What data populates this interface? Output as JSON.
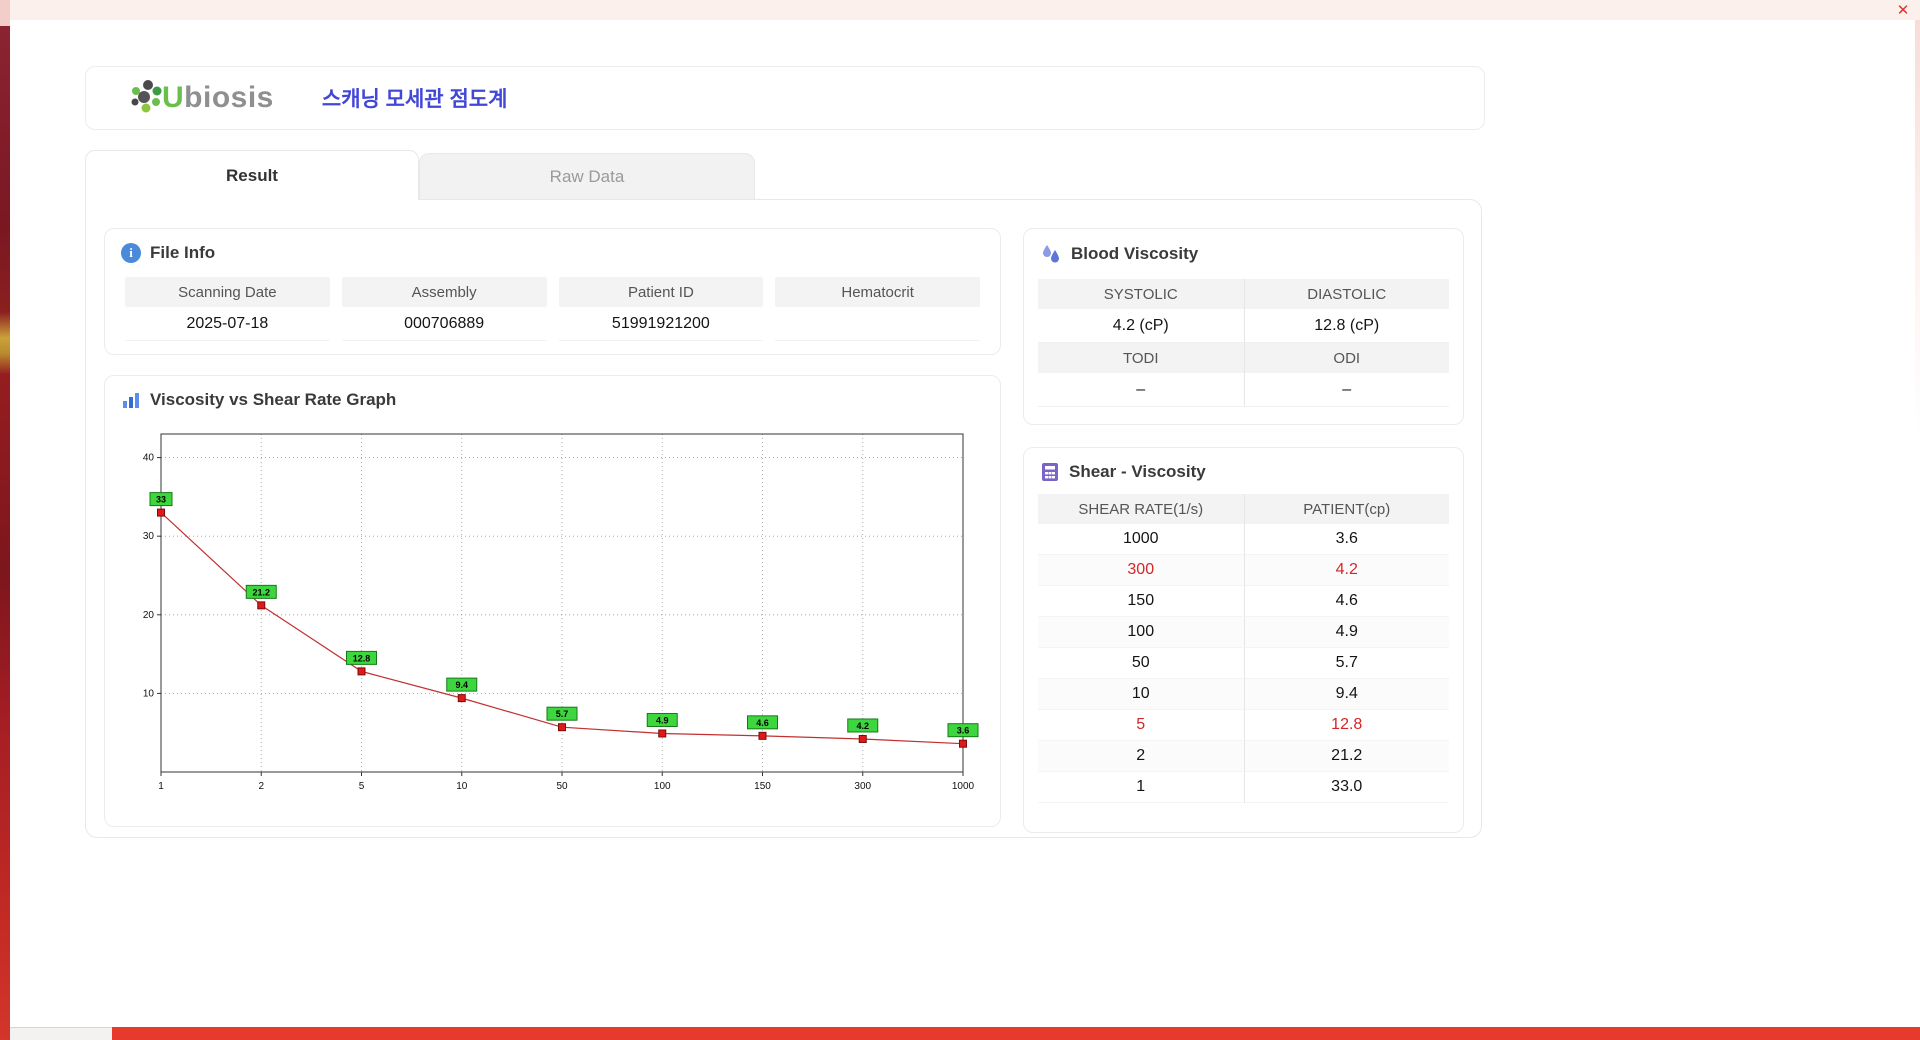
{
  "window": {
    "close_glyph": "✕"
  },
  "header": {
    "brand": "Ubiosis",
    "title": "스캐닝 모세관 점도계"
  },
  "tabs": {
    "result": "Result",
    "raw_data": "Raw Data"
  },
  "icons": {
    "info_glyph": "i"
  },
  "file_info": {
    "title": "File Info",
    "fields": [
      {
        "label": "Scanning Date",
        "value": "2025-07-18"
      },
      {
        "label": "Assembly",
        "value": "000706889"
      },
      {
        "label": "Patient ID",
        "value": "51991921200"
      },
      {
        "label": "Hematocrit",
        "value": ""
      }
    ]
  },
  "graph_section": {
    "title": "Viscosity vs Shear Rate Graph"
  },
  "blood_viscosity": {
    "title": "Blood Viscosity",
    "headers1": [
      "SYSTOLIC",
      "DIASTOLIC"
    ],
    "values1": [
      "4.2 (cP)",
      "12.8 (cP)"
    ],
    "headers2": [
      "TODI",
      "ODI"
    ],
    "values2": [
      "–",
      "–"
    ]
  },
  "shear_table": {
    "title": "Shear - Viscosity",
    "headers": [
      "SHEAR RATE(1/s)",
      "PATIENT(cp)"
    ],
    "rows": [
      [
        "1000",
        "3.6"
      ],
      [
        "300",
        "4.2"
      ],
      [
        "150",
        "4.6"
      ],
      [
        "100",
        "4.9"
      ],
      [
        "50",
        "5.7"
      ],
      [
        "10",
        "9.4"
      ],
      [
        "5",
        "12.8"
      ],
      [
        "2",
        "21.2"
      ],
      [
        "1",
        "33.0"
      ]
    ],
    "highlight_rows": [
      1,
      6
    ]
  },
  "chart_data": {
    "type": "line",
    "title": "Viscosity vs Shear Rate Graph",
    "xlabel": "",
    "ylabel": "",
    "x": [
      "1",
      "2",
      "5",
      "10",
      "50",
      "100",
      "150",
      "300",
      "1000"
    ],
    "values": [
      33,
      21.2,
      12.8,
      9.4,
      5.7,
      4.9,
      4.6,
      4.2,
      3.6
    ],
    "labels": [
      "33",
      "21.2",
      "12.8",
      "9.4",
      "5.7",
      "4.9",
      "4.6",
      "4.2",
      "3.6"
    ],
    "yticks": [
      10,
      20,
      30,
      40
    ],
    "ylim": [
      0,
      43
    ],
    "grid": "dotted",
    "line_color": "#c23030",
    "marker_color": "#e01818",
    "marker_stroke": "#7a0c0c",
    "label_bg": "#3ed63e",
    "label_stroke": "#157a15",
    "frame_color": "#333333"
  }
}
